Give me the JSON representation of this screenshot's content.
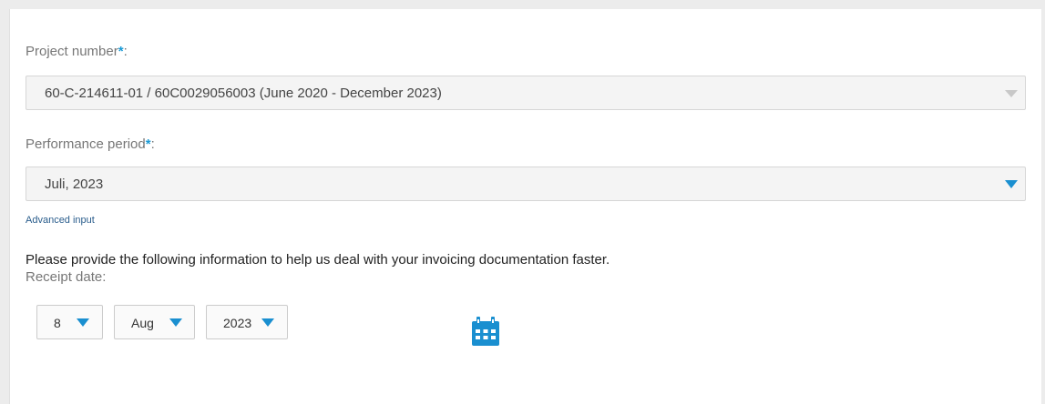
{
  "project": {
    "label": "Project number",
    "required_mark": "*",
    "colon": ":",
    "value": "60-C-214611-01 / 60C0029056003 (June 2020 - December 2023)"
  },
  "performance": {
    "label": "Performance period",
    "required_mark": "*",
    "colon": ":",
    "value": "Juli, 2023"
  },
  "advanced_input_label": "Advanced input",
  "info_text": "Please provide the following information to help us deal with your invoicing documentation faster.",
  "receipt": {
    "label": "Receipt date:",
    "day": "8",
    "month": "Aug",
    "year": "2023"
  },
  "icons": {
    "dropdown": "chevron-down-icon",
    "calendar": "calendar-icon"
  },
  "colors": {
    "accent": "#1a8fd0",
    "required": "#1a9ad6",
    "link": "#2a5d8c"
  }
}
